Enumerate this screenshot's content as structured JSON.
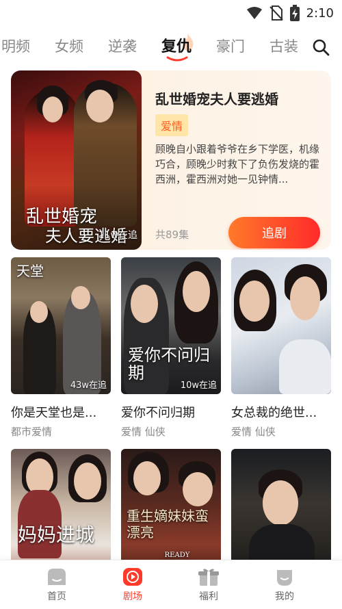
{
  "status_bar": {
    "time": "2:10",
    "icons": [
      "wifi-icon",
      "no-sim-icon",
      "battery-charging-icon"
    ]
  },
  "tabs": [
    {
      "label": "明频"
    },
    {
      "label": "女频"
    },
    {
      "label": "逆袭"
    },
    {
      "label": "复仇",
      "active": true
    },
    {
      "label": "豪门"
    },
    {
      "label": "古装"
    }
  ],
  "featured": {
    "title": "乱世婚宠夫人要逃婚",
    "tag": "爱情",
    "description": "顾晚自小跟着爷爷在乡下学医，机缘巧合，顾晚少时救下了负伤发烧的霍西洲，霍西洲对她一见钟情...",
    "episodes": "共89集",
    "follow_label": "追剧",
    "poster_title_line1": "乱世婚宠",
    "poster_title_line2": "夫人要逃婚",
    "poster_count": "11w在追"
  },
  "grid": [
    {
      "title": "你是天堂也是...",
      "tags": "都市爱情",
      "count": "43w在追",
      "poster_text": "天堂"
    },
    {
      "title": "爱你不问归期",
      "tags": "爱情 仙侠",
      "count": "10w在追",
      "poster_text": "爱你不问归期"
    },
    {
      "title": "女总裁的绝世...",
      "tags": "爱情 仙侠",
      "count": "",
      "poster_text": ""
    },
    {
      "title": "",
      "tags": "",
      "count": "",
      "poster_text": "妈妈进城"
    },
    {
      "title": "",
      "tags": "",
      "count": "",
      "poster_text": "重生嫡妹妹蛮漂亮",
      "poster_subtext": "READY FOR HIS REVENGE"
    },
    {
      "title": "",
      "tags": "",
      "count": "",
      "poster_text": ""
    }
  ],
  "bottom_nav": [
    {
      "label": "首页",
      "icon": "home-icon"
    },
    {
      "label": "剧场",
      "icon": "theater-play-icon",
      "active": true
    },
    {
      "label": "福利",
      "icon": "gift-icon"
    },
    {
      "label": "我的",
      "icon": "profile-icon"
    }
  ],
  "colors": {
    "accent": "#ff3a2a",
    "accent_gradient_start": "#ff7a2a",
    "tag_bg": "#ffe6a8",
    "tag_text": "#ff5a1f"
  }
}
